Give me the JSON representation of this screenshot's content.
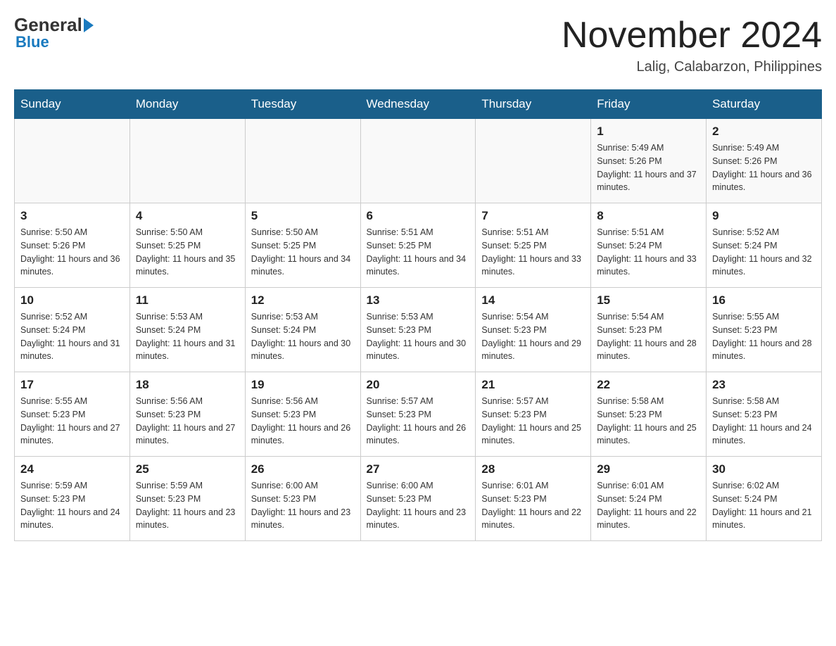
{
  "header": {
    "logo_general": "General",
    "logo_blue": "Blue",
    "month_title": "November 2024",
    "location": "Lalig, Calabarzon, Philippines"
  },
  "calendar": {
    "days_of_week": [
      "Sunday",
      "Monday",
      "Tuesday",
      "Wednesday",
      "Thursday",
      "Friday",
      "Saturday"
    ],
    "weeks": [
      [
        {
          "day": "",
          "sunrise": "",
          "sunset": "",
          "daylight": ""
        },
        {
          "day": "",
          "sunrise": "",
          "sunset": "",
          "daylight": ""
        },
        {
          "day": "",
          "sunrise": "",
          "sunset": "",
          "daylight": ""
        },
        {
          "day": "",
          "sunrise": "",
          "sunset": "",
          "daylight": ""
        },
        {
          "day": "",
          "sunrise": "",
          "sunset": "",
          "daylight": ""
        },
        {
          "day": "1",
          "sunrise": "Sunrise: 5:49 AM",
          "sunset": "Sunset: 5:26 PM",
          "daylight": "Daylight: 11 hours and 37 minutes."
        },
        {
          "day": "2",
          "sunrise": "Sunrise: 5:49 AM",
          "sunset": "Sunset: 5:26 PM",
          "daylight": "Daylight: 11 hours and 36 minutes."
        }
      ],
      [
        {
          "day": "3",
          "sunrise": "Sunrise: 5:50 AM",
          "sunset": "Sunset: 5:26 PM",
          "daylight": "Daylight: 11 hours and 36 minutes."
        },
        {
          "day": "4",
          "sunrise": "Sunrise: 5:50 AM",
          "sunset": "Sunset: 5:25 PM",
          "daylight": "Daylight: 11 hours and 35 minutes."
        },
        {
          "day": "5",
          "sunrise": "Sunrise: 5:50 AM",
          "sunset": "Sunset: 5:25 PM",
          "daylight": "Daylight: 11 hours and 34 minutes."
        },
        {
          "day": "6",
          "sunrise": "Sunrise: 5:51 AM",
          "sunset": "Sunset: 5:25 PM",
          "daylight": "Daylight: 11 hours and 34 minutes."
        },
        {
          "day": "7",
          "sunrise": "Sunrise: 5:51 AM",
          "sunset": "Sunset: 5:25 PM",
          "daylight": "Daylight: 11 hours and 33 minutes."
        },
        {
          "day": "8",
          "sunrise": "Sunrise: 5:51 AM",
          "sunset": "Sunset: 5:24 PM",
          "daylight": "Daylight: 11 hours and 33 minutes."
        },
        {
          "day": "9",
          "sunrise": "Sunrise: 5:52 AM",
          "sunset": "Sunset: 5:24 PM",
          "daylight": "Daylight: 11 hours and 32 minutes."
        }
      ],
      [
        {
          "day": "10",
          "sunrise": "Sunrise: 5:52 AM",
          "sunset": "Sunset: 5:24 PM",
          "daylight": "Daylight: 11 hours and 31 minutes."
        },
        {
          "day": "11",
          "sunrise": "Sunrise: 5:53 AM",
          "sunset": "Sunset: 5:24 PM",
          "daylight": "Daylight: 11 hours and 31 minutes."
        },
        {
          "day": "12",
          "sunrise": "Sunrise: 5:53 AM",
          "sunset": "Sunset: 5:24 PM",
          "daylight": "Daylight: 11 hours and 30 minutes."
        },
        {
          "day": "13",
          "sunrise": "Sunrise: 5:53 AM",
          "sunset": "Sunset: 5:23 PM",
          "daylight": "Daylight: 11 hours and 30 minutes."
        },
        {
          "day": "14",
          "sunrise": "Sunrise: 5:54 AM",
          "sunset": "Sunset: 5:23 PM",
          "daylight": "Daylight: 11 hours and 29 minutes."
        },
        {
          "day": "15",
          "sunrise": "Sunrise: 5:54 AM",
          "sunset": "Sunset: 5:23 PM",
          "daylight": "Daylight: 11 hours and 28 minutes."
        },
        {
          "day": "16",
          "sunrise": "Sunrise: 5:55 AM",
          "sunset": "Sunset: 5:23 PM",
          "daylight": "Daylight: 11 hours and 28 minutes."
        }
      ],
      [
        {
          "day": "17",
          "sunrise": "Sunrise: 5:55 AM",
          "sunset": "Sunset: 5:23 PM",
          "daylight": "Daylight: 11 hours and 27 minutes."
        },
        {
          "day": "18",
          "sunrise": "Sunrise: 5:56 AM",
          "sunset": "Sunset: 5:23 PM",
          "daylight": "Daylight: 11 hours and 27 minutes."
        },
        {
          "day": "19",
          "sunrise": "Sunrise: 5:56 AM",
          "sunset": "Sunset: 5:23 PM",
          "daylight": "Daylight: 11 hours and 26 minutes."
        },
        {
          "day": "20",
          "sunrise": "Sunrise: 5:57 AM",
          "sunset": "Sunset: 5:23 PM",
          "daylight": "Daylight: 11 hours and 26 minutes."
        },
        {
          "day": "21",
          "sunrise": "Sunrise: 5:57 AM",
          "sunset": "Sunset: 5:23 PM",
          "daylight": "Daylight: 11 hours and 25 minutes."
        },
        {
          "day": "22",
          "sunrise": "Sunrise: 5:58 AM",
          "sunset": "Sunset: 5:23 PM",
          "daylight": "Daylight: 11 hours and 25 minutes."
        },
        {
          "day": "23",
          "sunrise": "Sunrise: 5:58 AM",
          "sunset": "Sunset: 5:23 PM",
          "daylight": "Daylight: 11 hours and 24 minutes."
        }
      ],
      [
        {
          "day": "24",
          "sunrise": "Sunrise: 5:59 AM",
          "sunset": "Sunset: 5:23 PM",
          "daylight": "Daylight: 11 hours and 24 minutes."
        },
        {
          "day": "25",
          "sunrise": "Sunrise: 5:59 AM",
          "sunset": "Sunset: 5:23 PM",
          "daylight": "Daylight: 11 hours and 23 minutes."
        },
        {
          "day": "26",
          "sunrise": "Sunrise: 6:00 AM",
          "sunset": "Sunset: 5:23 PM",
          "daylight": "Daylight: 11 hours and 23 minutes."
        },
        {
          "day": "27",
          "sunrise": "Sunrise: 6:00 AM",
          "sunset": "Sunset: 5:23 PM",
          "daylight": "Daylight: 11 hours and 23 minutes."
        },
        {
          "day": "28",
          "sunrise": "Sunrise: 6:01 AM",
          "sunset": "Sunset: 5:23 PM",
          "daylight": "Daylight: 11 hours and 22 minutes."
        },
        {
          "day": "29",
          "sunrise": "Sunrise: 6:01 AM",
          "sunset": "Sunset: 5:24 PM",
          "daylight": "Daylight: 11 hours and 22 minutes."
        },
        {
          "day": "30",
          "sunrise": "Sunrise: 6:02 AM",
          "sunset": "Sunset: 5:24 PM",
          "daylight": "Daylight: 11 hours and 21 minutes."
        }
      ]
    ]
  }
}
